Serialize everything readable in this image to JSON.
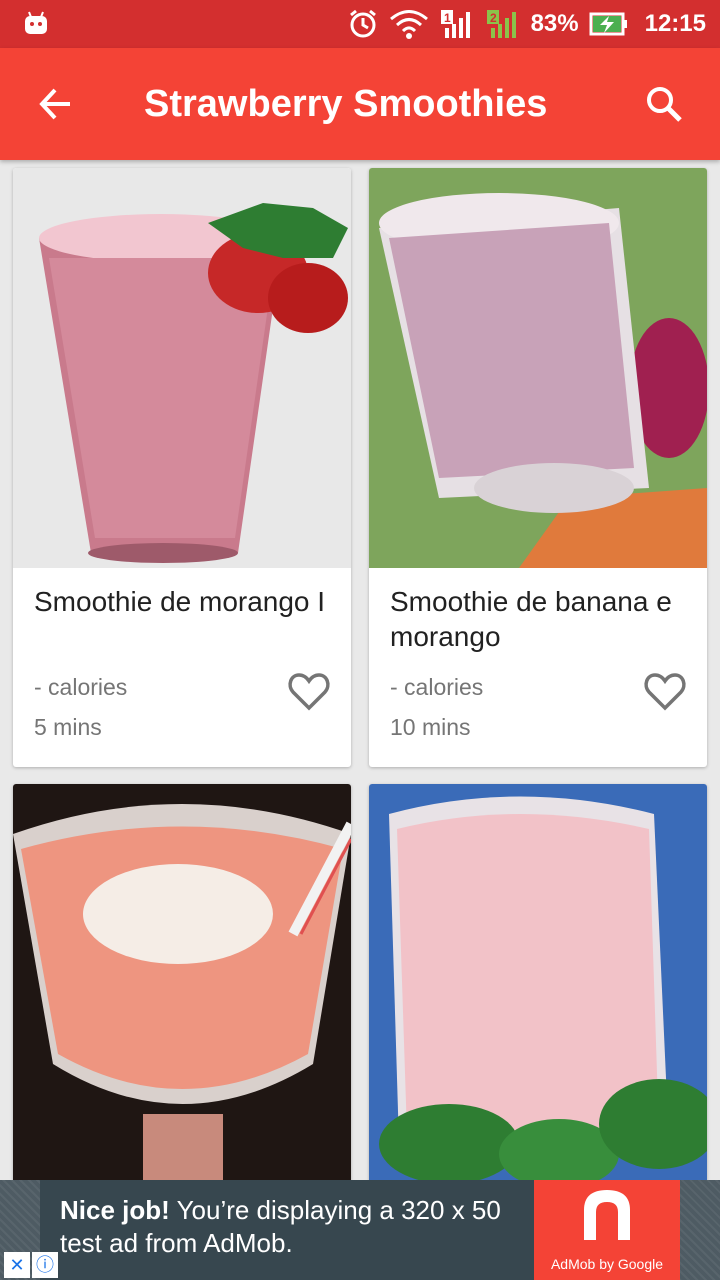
{
  "status_bar": {
    "battery": "83%",
    "time": "12:15",
    "icons": [
      "android-icon",
      "alarm-icon",
      "wifi-icon",
      "signal-sim1-icon",
      "signal-sim2-icon",
      "battery-charging-icon"
    ]
  },
  "app_bar": {
    "title": "Strawberry Smoothies",
    "back_icon": "arrow-back-icon",
    "search_icon": "search-icon"
  },
  "recipes": [
    {
      "title": "Smoothie de morango I",
      "calories": "- calories",
      "time": "5 mins",
      "image": "strawberry-smoothie-photo"
    },
    {
      "title": "Smoothie de banana e morango",
      "calories": "- calories",
      "time": "10 mins",
      "image": "banana-strawberry-smoothie-photo"
    },
    {
      "title": "",
      "calories": "",
      "time": "",
      "image": "coconut-smoothie-photo"
    },
    {
      "title": "",
      "calories": "",
      "time": "",
      "image": "pink-smoothie-mint-photo"
    }
  ],
  "ad": {
    "headline": "Nice job!",
    "body": "You’re displaying a 320 x 50 test ad from AdMob.",
    "logo_caption": "AdMob by Google"
  },
  "colors": {
    "status_bar": "#d32f2f",
    "app_bar": "#f44336",
    "ad_background": "#37474f"
  }
}
